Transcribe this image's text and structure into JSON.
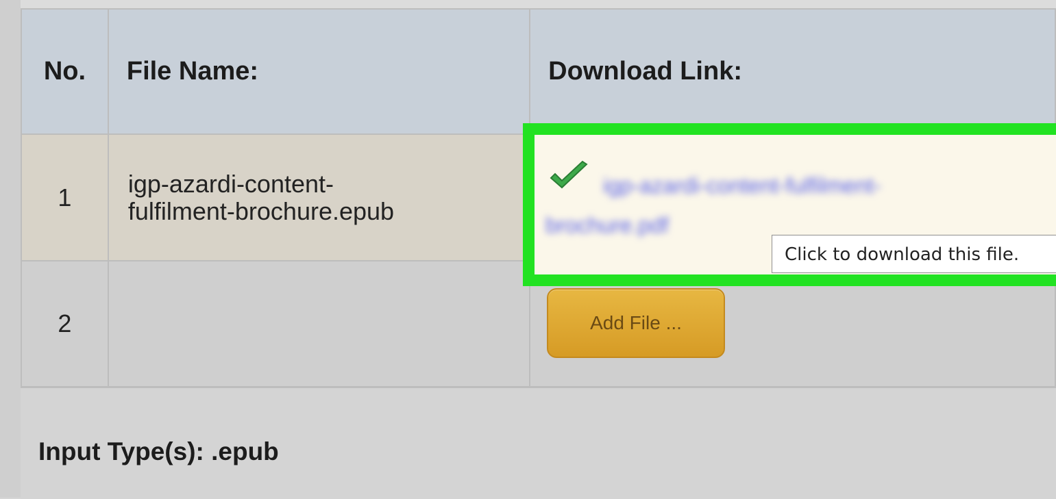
{
  "table": {
    "headers": {
      "no": "No.",
      "file_name": "File Name:",
      "download_link": "Download Link:"
    },
    "rows": [
      {
        "no": "1",
        "file_name_line1": "igp-azardi-content-",
        "file_name_line2": "fulfilment-brochure.epub",
        "link_line1": "igp-azardi-content-fulfilment-",
        "link_line2": "brochure.pdf"
      },
      {
        "no": "2"
      }
    ]
  },
  "tooltip": "Click to download this file.",
  "add_file_button": "Add File ...",
  "footer": {
    "input_types": "Input Type(s): .epub"
  },
  "colors": {
    "highlight": "#22e222",
    "link": "#5b63e8",
    "button": "#d69b25"
  },
  "icons": {
    "status": "checkmark-icon"
  }
}
